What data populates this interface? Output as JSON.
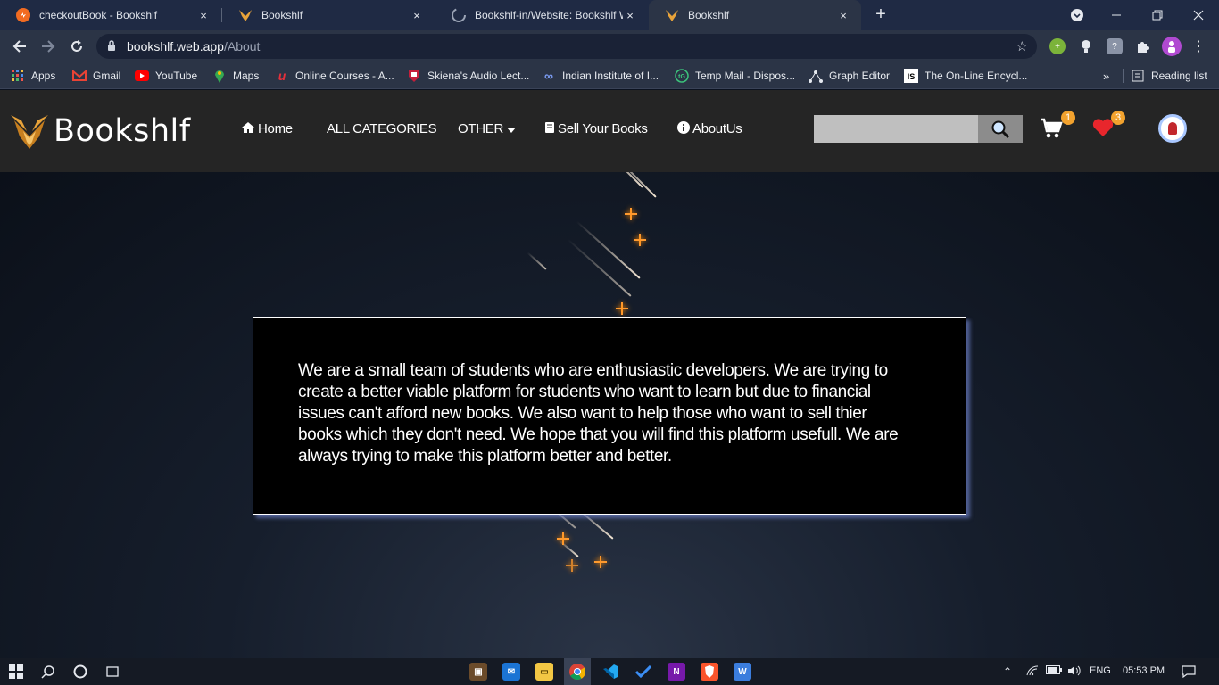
{
  "browser": {
    "tabs": [
      {
        "label": "checkoutBook - Bookshlf",
        "icon": "orange-circle-icon"
      },
      {
        "label": "Bookshlf",
        "icon": "bookshlf-bird-icon"
      },
      {
        "label": "Bookshlf-in/Website: Bookshlf W",
        "icon": "github-icon"
      },
      {
        "label": "Bookshlf",
        "icon": "bookshlf-bird-icon"
      }
    ],
    "tab_close": "×",
    "new_tab": "+",
    "url_host": "bookshlf.web.app",
    "url_path": "/About",
    "bookmarks": [
      {
        "label": "Apps",
        "icon": "apps-grid-icon"
      },
      {
        "label": "Gmail",
        "icon": "gmail-icon"
      },
      {
        "label": "YouTube",
        "icon": "youtube-icon"
      },
      {
        "label": "Maps",
        "icon": "maps-pin-icon"
      },
      {
        "label": "Online Courses - A...",
        "icon": "udemy-icon"
      },
      {
        "label": "Skiena's Audio Lect...",
        "icon": "shield-icon"
      },
      {
        "label": "Indian Institute of I...",
        "icon": "link-icon"
      },
      {
        "label": "Temp Mail - Dispos...",
        "icon": "tempmail-icon"
      },
      {
        "label": "Graph Editor",
        "icon": "graph-icon"
      },
      {
        "label": "The On-Line Encycl...",
        "icon": "oeis-icon"
      }
    ],
    "bookmarks_overflow": "»",
    "reading_list": "Reading list",
    "badge_ext": "0"
  },
  "site": {
    "brand": "Bookshlf",
    "nav": {
      "home": "Home",
      "categories": "ALL CATEGORIES",
      "other": "OTHER",
      "sell": "Sell Your Books",
      "about": "AboutUs"
    },
    "search_placeholder": "",
    "cart_count": "1",
    "wishlist_count": "3"
  },
  "about": {
    "text": "We are a small team of students who are enthusiastic developers. We are trying to create a better viable platform for students who want to learn but due to financial issues can't afford new books. We also want to help those who want to sell thier books which they don't need. We hope that you will find this platform usefull. We are always trying to make this platform better and better."
  },
  "taskbar": {
    "lang": "ENG",
    "time": "05:53 PM"
  },
  "colors": {
    "badge": "#f2a22e",
    "heart": "#e8262c",
    "navbar": "#252525",
    "spark": "#ff9a2e"
  }
}
